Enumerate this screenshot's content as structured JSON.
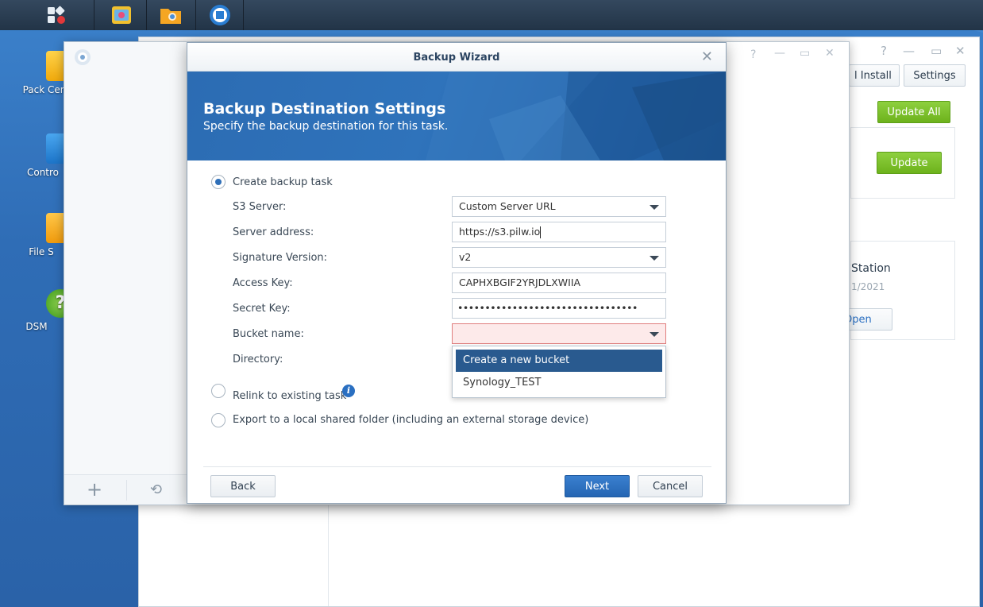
{
  "desktop": {
    "icons": [
      {
        "label": "Pack Cen",
        "icon": "package-center-icon"
      },
      {
        "label": "Contro",
        "icon": "control-panel-icon"
      },
      {
        "label": "File S",
        "icon": "file-station-icon"
      },
      {
        "label": "DSM",
        "icon": "help-icon"
      }
    ]
  },
  "package_center": {
    "install_label": "l Install",
    "settings_label": "Settings",
    "update_all_label": "Update All",
    "update_label": "Update",
    "card_title": "Station",
    "card_date": "1/2021",
    "open_label": "Open"
  },
  "wizard": {
    "title": "Backup Wizard",
    "banner_title": "Backup Destination Settings",
    "banner_subtitle": "Specify the backup destination for this task.",
    "option_create": "Create backup task",
    "fields": {
      "s3_server_label": "S3 Server:",
      "s3_server_value": "Custom Server URL",
      "server_address_label": "Server address:",
      "server_address_value": "https://s3.pilw.io",
      "signature_label": "Signature Version:",
      "signature_value": "v2",
      "access_key_label": "Access Key:",
      "access_key_value": "CAPHXBGIF2YRJDLXWIIA",
      "secret_key_label": "Secret Key:",
      "secret_key_value": "•••••••••••••••••••••••••••••••••",
      "bucket_label": "Bucket name:",
      "bucket_value": "",
      "directory_label": "Directory:"
    },
    "bucket_options": [
      "Create a new bucket",
      "Synology_TEST"
    ],
    "option_relink": "Relink to existing task",
    "option_export": "Export to a local shared folder (including an external storage device)",
    "back_label": "Back",
    "next_label": "Next",
    "cancel_label": "Cancel"
  },
  "colors": {
    "accent": "#2f6fb8",
    "banner": "#2c6cb3",
    "green": "#7cc12a",
    "error_bg": "#fdeaea"
  }
}
